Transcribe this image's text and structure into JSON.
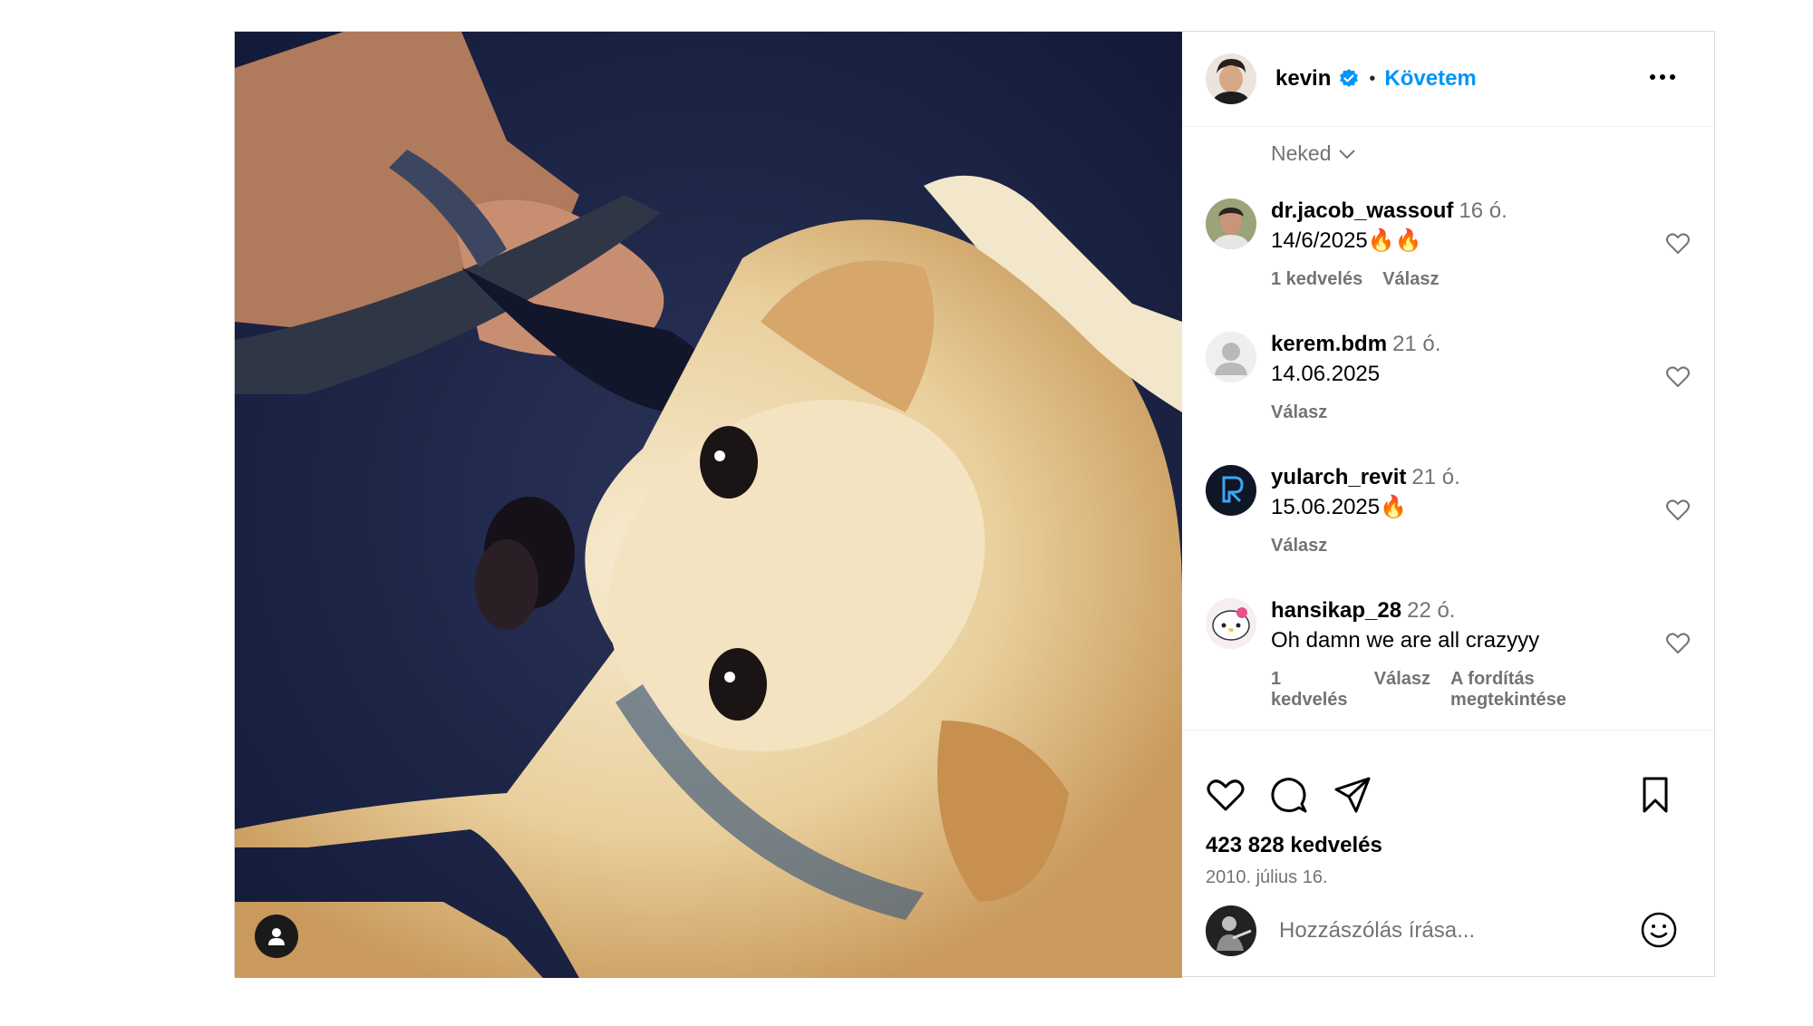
{
  "post": {
    "author": "kevin",
    "verified": true,
    "separator": "•",
    "follow_label": "Követem",
    "sort_label": "Neked",
    "likes_text": "423 828 kedvelés",
    "date_text": "2010. július 16."
  },
  "comments": [
    {
      "user": "dr.jacob_wassouf",
      "time": "16 ó.",
      "text": "14/6/2025🔥🔥",
      "likes": "1 kedvelés",
      "reply": "Válasz",
      "translate": ""
    },
    {
      "user": "kerem.bdm",
      "time": "21 ó.",
      "text": "14.06.2025",
      "likes": "",
      "reply": "Válasz",
      "translate": ""
    },
    {
      "user": "yularch_revit",
      "time": "21 ó.",
      "text": "15.06.2025🔥",
      "likes": "",
      "reply": "Válasz",
      "translate": ""
    },
    {
      "user": "hansikap_28",
      "time": "22 ó.",
      "text": "Oh damn we are all crazyyy",
      "likes": "1 kedvelés",
      "reply": "Válasz",
      "translate": "A fordítás megtekintése"
    }
  ],
  "composer": {
    "placeholder": "Hozzászólás írása..."
  },
  "colors": {
    "link": "#0095f6",
    "muted": "#737373",
    "border": "#dbdbdb"
  },
  "icons": {
    "like": "heart-icon",
    "comment": "comment-icon",
    "share": "share-icon",
    "save": "bookmark-icon",
    "more": "more-horizontal-icon",
    "emoji": "emoji-icon",
    "sort": "chevron-down-icon",
    "user_tag": "user-tag-icon"
  }
}
